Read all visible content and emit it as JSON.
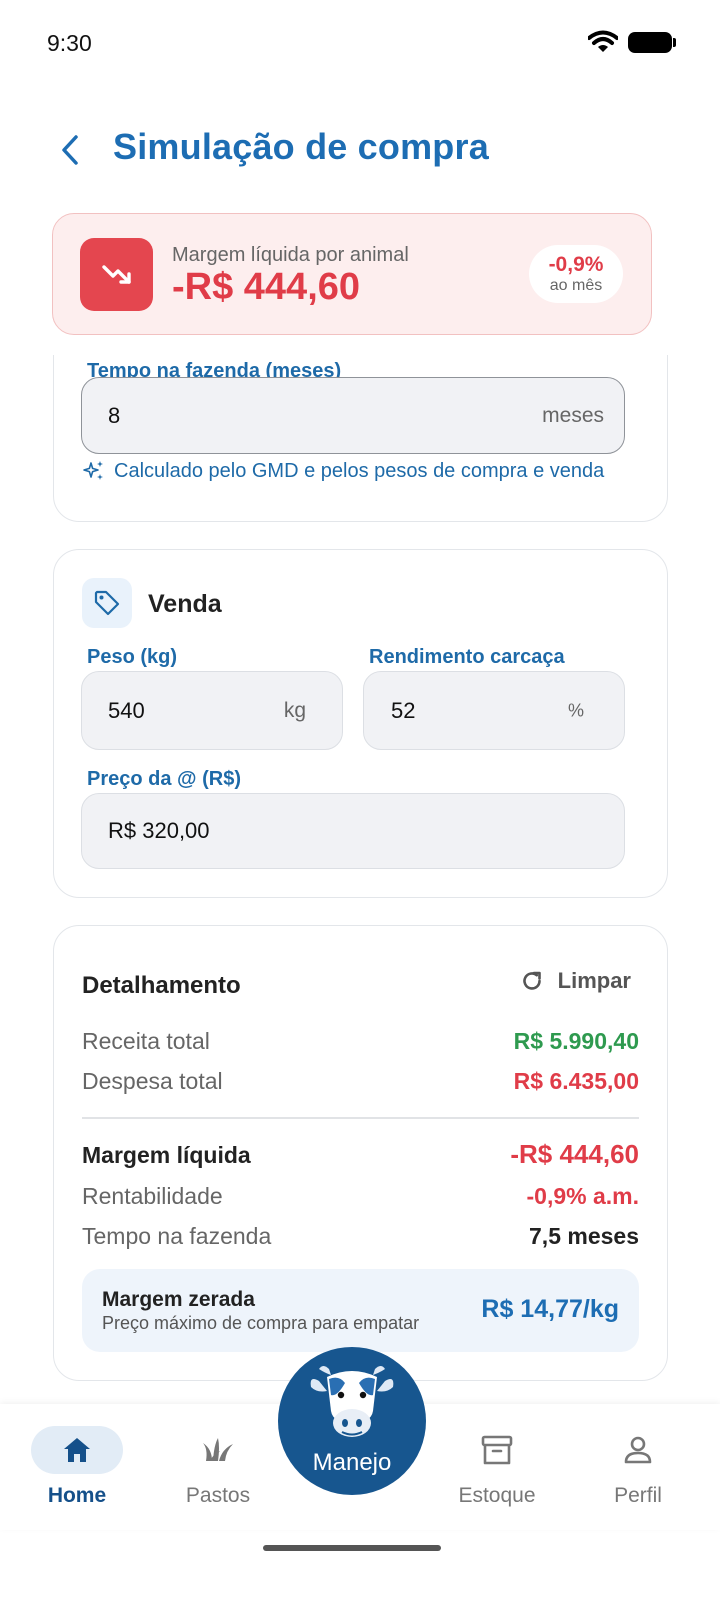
{
  "status_bar": {
    "time": "9:30"
  },
  "header": {
    "title": "Simulação de compra"
  },
  "margin_banner": {
    "label": "Margem líquida por animal",
    "value": "-R$ 444,60",
    "percent": "-0,9%",
    "percent_sub": "ao mês"
  },
  "time_section": {
    "label": "Tempo na fazenda (meses)",
    "value": "8",
    "suffix": "meses",
    "hint": "Calculado pelo GMD e pelos pesos de compra e venda"
  },
  "venda": {
    "title": "Venda",
    "peso": {
      "label": "Peso (kg)",
      "value": "540",
      "suffix": "kg"
    },
    "rendimento": {
      "label": "Rendimento carcaça",
      "value": "52",
      "suffix": "%"
    },
    "preco": {
      "label": "Preço da @ (R$)",
      "value": "R$ 320,00"
    }
  },
  "detail": {
    "title": "Detalhamento",
    "clear_label": "Limpar",
    "receita": {
      "label": "Receita total",
      "value": "R$ 5.990,40"
    },
    "despesa": {
      "label": "Despesa total",
      "value": "R$ 6.435,00"
    },
    "margem": {
      "label": "Margem líquida",
      "value": "-R$ 444,60"
    },
    "rentabilidade": {
      "label": "Rentabilidade",
      "value": "-0,9% a.m."
    },
    "tempo": {
      "label": "Tempo na fazenda",
      "value": "7,5 meses"
    },
    "breakeven": {
      "title": "Margem zerada",
      "subtitle": "Preço máximo de compra para empatar",
      "value": "R$ 14,77/kg"
    }
  },
  "nav": {
    "home": "Home",
    "pastos": "Pastos",
    "manejo": "Manejo",
    "estoque": "Estoque",
    "perfil": "Perfil"
  },
  "colors": {
    "primary": "#1d6db3",
    "negative": "#e03c48",
    "positive": "#2e9a4f",
    "nav_dark": "#17568f"
  }
}
